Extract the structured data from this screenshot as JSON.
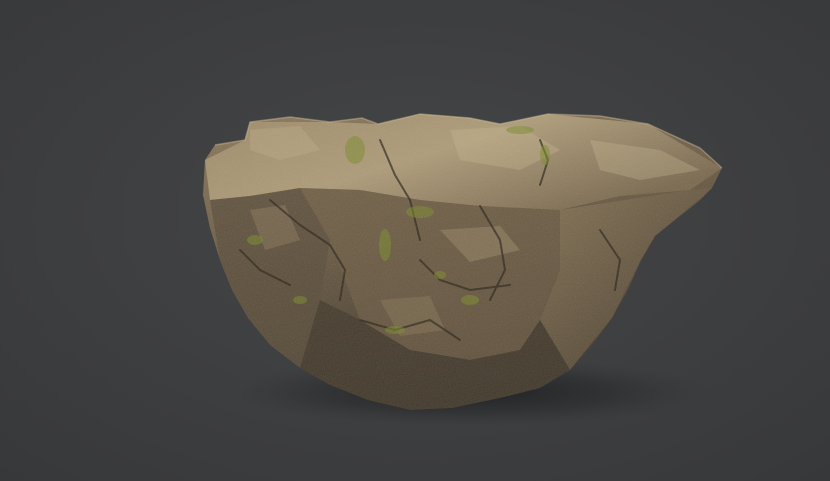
{
  "scene": {
    "subject": "rock-icon",
    "palette": {
      "background": "#3a3b3d",
      "background_light": "#434446",
      "rock_dark": "#3a3226",
      "rock_mid": "#6a5a44",
      "rock_light": "#9a8766",
      "rock_highlight": "#c8b68f",
      "moss": "#7a8a2a",
      "shadow": "#1e1f20"
    }
  }
}
